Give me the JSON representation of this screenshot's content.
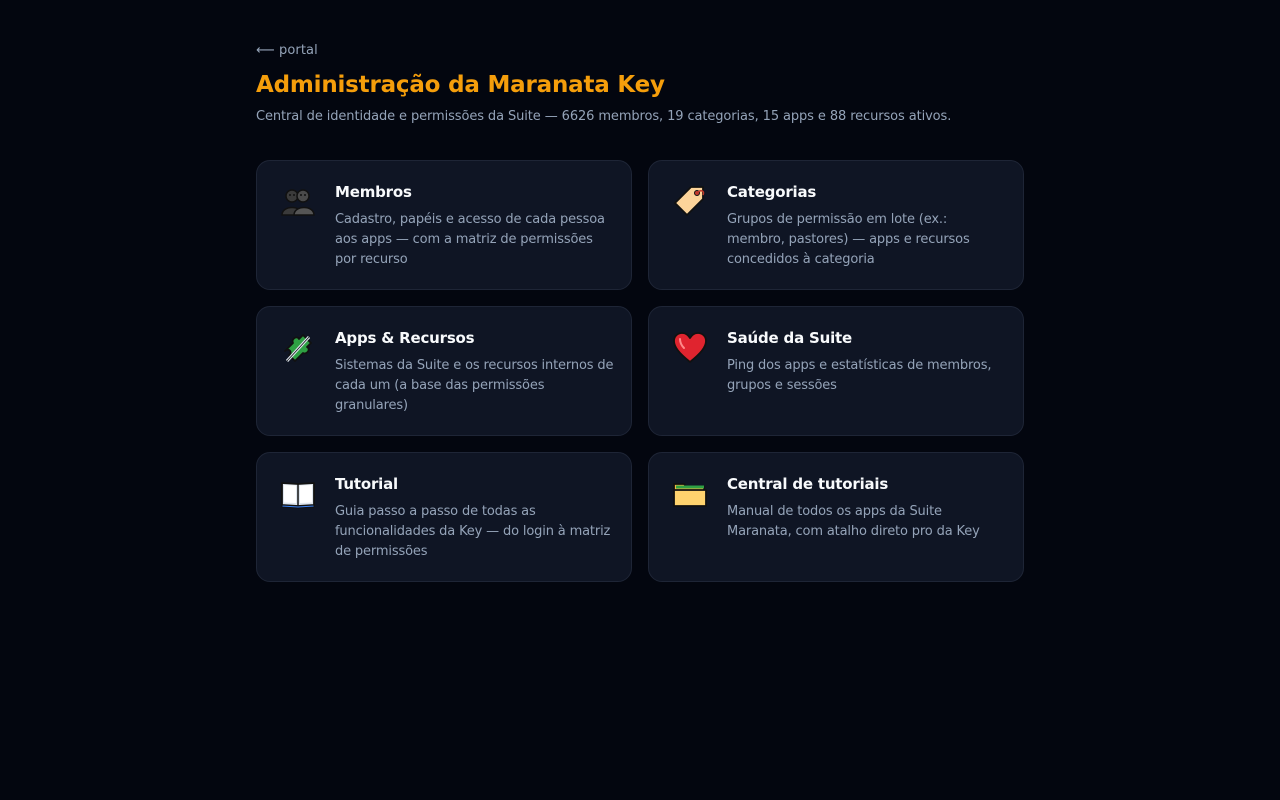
{
  "header": {
    "back_label": "⟵ portal",
    "title": "Administração da Maranata Key",
    "subtitle": "Central de identidade e permissões da Suite — 6626 membros, 19 categorias, 15 apps e 88 recursos ativos."
  },
  "cards": [
    {
      "title": "Membros",
      "description": "Cadastro, papéis e acesso de cada pessoa aos apps — com a matriz de permissões por recurso",
      "icon": "people-icon"
    },
    {
      "title": "Categorias",
      "description": "Grupos de permissão em lote (ex.: membro, pastores) — apps e recursos concedidos à categoria",
      "icon": "tag-icon"
    },
    {
      "title": "Apps & Recursos",
      "description": "Sistemas da Suite e os recursos internos de cada um (a base das permissões granulares)",
      "icon": "puzzle-icon"
    },
    {
      "title": "Saúde da Suite",
      "description": "Ping dos apps e estatísticas de membros, grupos e sessões",
      "icon": "heart-icon"
    },
    {
      "title": "Tutorial",
      "description": "Guia passo a passo de todas as funcionalidades da Key — do login à matriz de permissões",
      "icon": "book-icon"
    },
    {
      "title": "Central de tutoriais",
      "description": "Manual de todos os apps da Suite Maranata, com atalho direto pro da Key",
      "icon": "folder-icon"
    }
  ],
  "colors": {
    "background": "#03060f",
    "accent": "#f59e0b",
    "card_bg": "#0f1524",
    "card_border": "#1e2536",
    "muted_text": "#94a3b8"
  }
}
